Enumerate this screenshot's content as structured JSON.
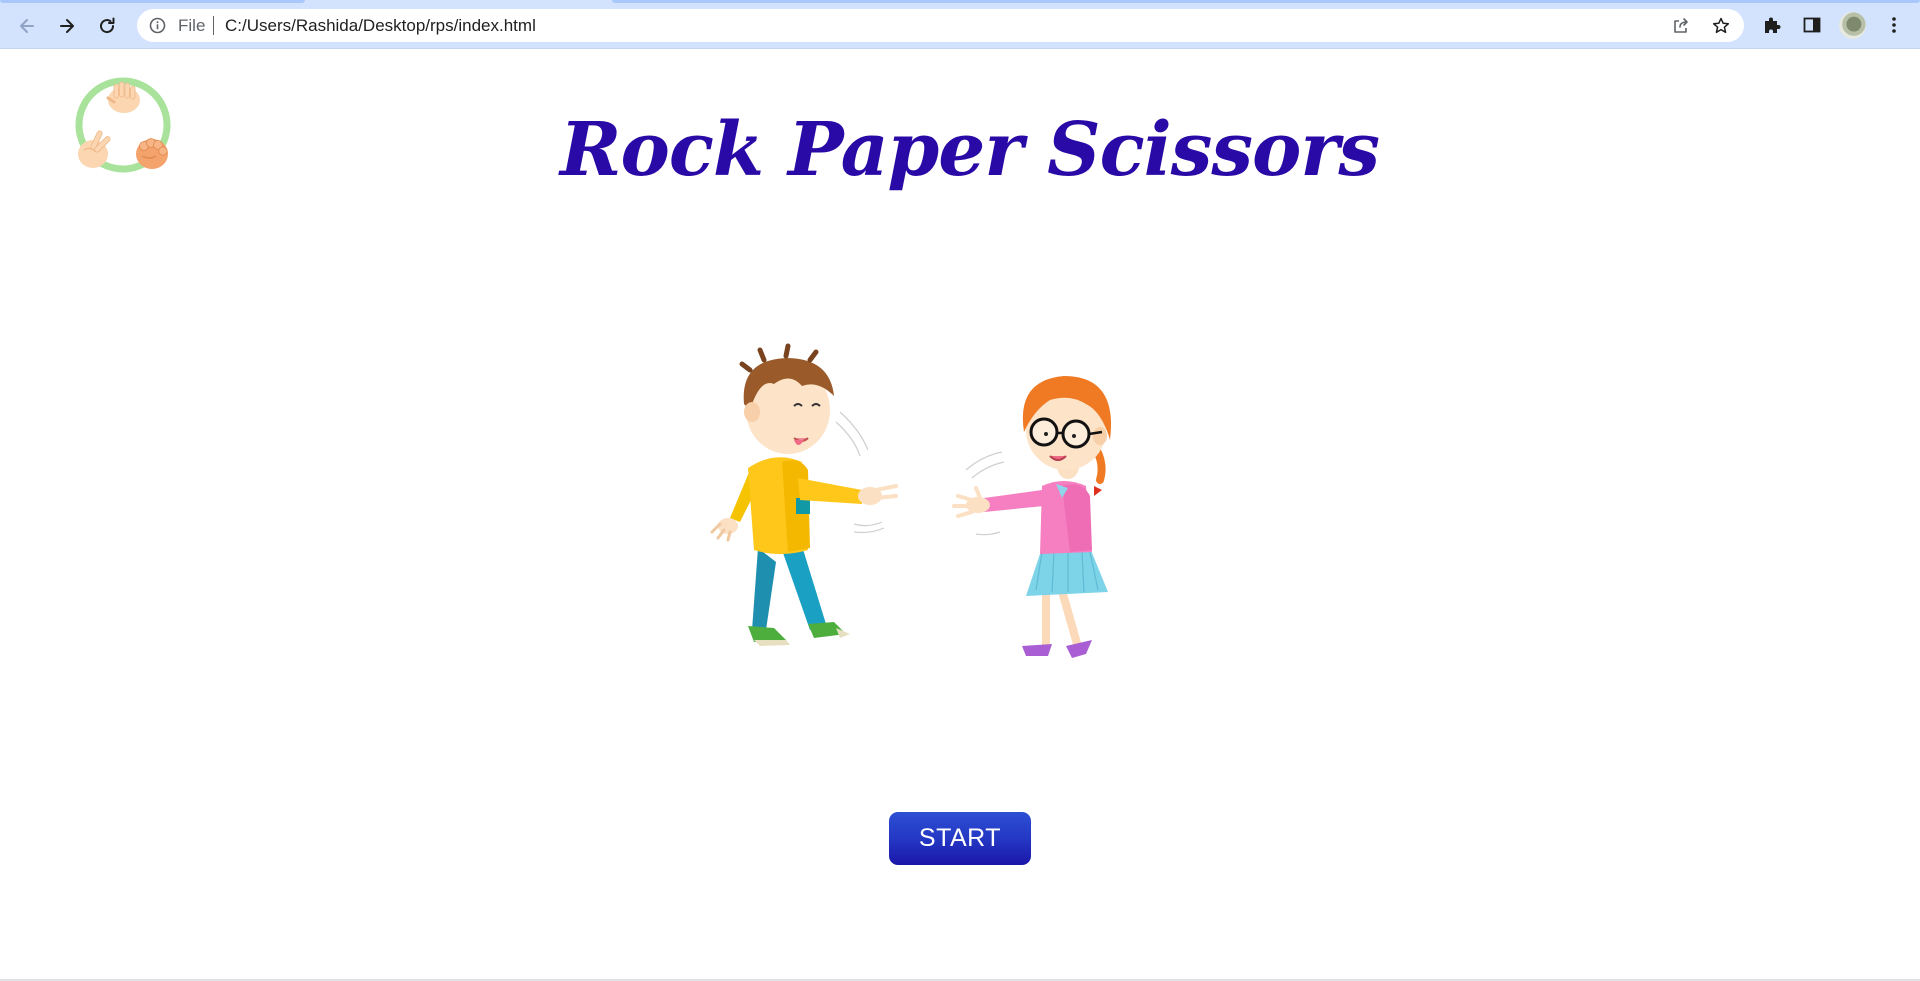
{
  "browser": {
    "omnibox": {
      "scheme_label": "File",
      "url": "C:/Users/Rashida/Desktop/rps/index.html"
    },
    "icons": {
      "back": "back-arrow-icon",
      "forward": "forward-arrow-icon",
      "reload": "reload-icon",
      "info": "info-icon",
      "share": "share-icon",
      "bookmark": "star-icon",
      "extensions": "puzzle-icon",
      "side_panel": "side-panel-icon",
      "menu": "kebab-menu-icon"
    },
    "colors": {
      "chrome_bg": "#d3e3fd",
      "omnibox_bg": "#ffffff"
    }
  },
  "page": {
    "title": "Rock Paper Scissors",
    "start_label": "START",
    "colors": {
      "title": "#2a0aa6",
      "button": "#2438c4",
      "button_text": "#ffffff"
    }
  }
}
